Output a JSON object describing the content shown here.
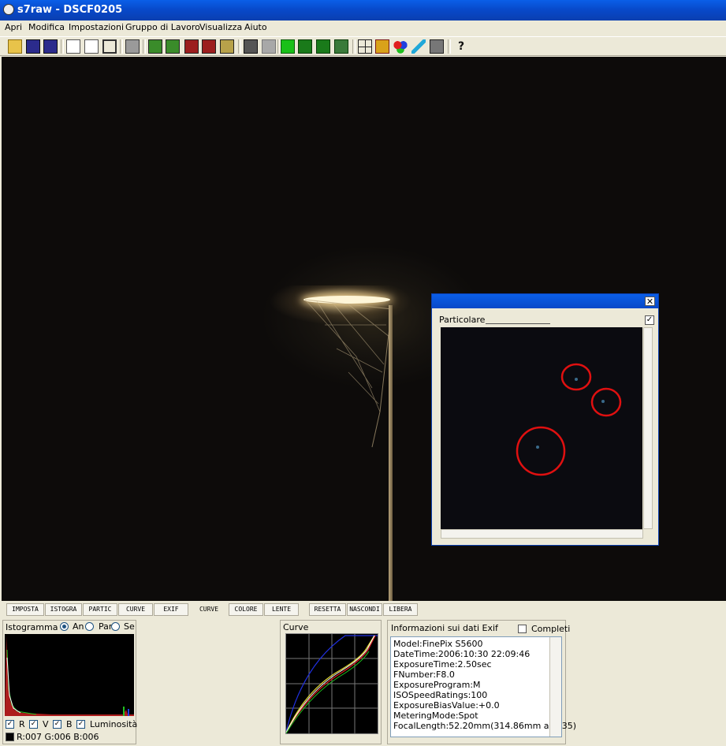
{
  "window": {
    "title": "s7raw - DSCF0205"
  },
  "menu": [
    "Apri",
    "Modifica",
    "Impostazioni",
    "Gruppo di Lavoro",
    "Visualizza",
    "Aiuto"
  ],
  "toolbar": {
    "icons": [
      "open-folder-icon",
      "save-icon",
      "save-as-icon",
      "copy-icon",
      "find-icon",
      "crop-icon",
      "layers-icon",
      "psd-16-icon",
      "psd-8-icon",
      "tiff-16-icon",
      "tiff-8-icon",
      "jpg-icon",
      "copy-window-icon",
      "gray-square-icon",
      "green-view-icon",
      "grid-view-icon",
      "quad-view-icon",
      "preview-icon",
      "crosshair-grid-icon",
      "highlight-icon",
      "rgb-icon",
      "color-picker-icon",
      "compare-icon",
      "help-icon"
    ]
  },
  "particolare": {
    "title": "Particolare",
    "close": "✕",
    "checked": "✓"
  },
  "tabs": [
    "IMPOSTA",
    "ISTOGRA",
    "PARTIC",
    "CURVE",
    "EXIF",
    "CURVE",
    "COLORE",
    "LENTE",
    "RESETTA",
    "NASCONDI",
    "LIBERA"
  ],
  "histogram": {
    "title": "Istogramma",
    "radios": [
      {
        "label": "An",
        "checked": true
      },
      {
        "label": "Par",
        "checked": false
      },
      {
        "label": "Se",
        "checked": false
      }
    ],
    "checks": [
      {
        "label": "R",
        "checked": true
      },
      {
        "label": "V",
        "checked": true
      },
      {
        "label": "B",
        "checked": true
      },
      {
        "label": "Luminosità",
        "checked": true
      }
    ],
    "readout": "R:007 G:006 B:006"
  },
  "curve": {
    "title": "Curve"
  },
  "exif": {
    "title": "Informazioni sui dati Exif",
    "complete_label": "Completi",
    "lines": [
      "Model:FinePix S5600",
      "DateTime:2006:10:30 22:09:46",
      "ExposureTime:2.50sec",
      "FNumber:F8.0",
      "ExposureProgram:M",
      "ISOSpeedRatings:100",
      "ExposureBiasValue:+0.0",
      "MeteringMode:Spot",
      "FocalLength:52.20mm(314.86mm as 135)"
    ]
  },
  "colors": {
    "titlebar": "#0A5FE8",
    "annotation": "#E01010",
    "face": "#ECE9D8"
  }
}
